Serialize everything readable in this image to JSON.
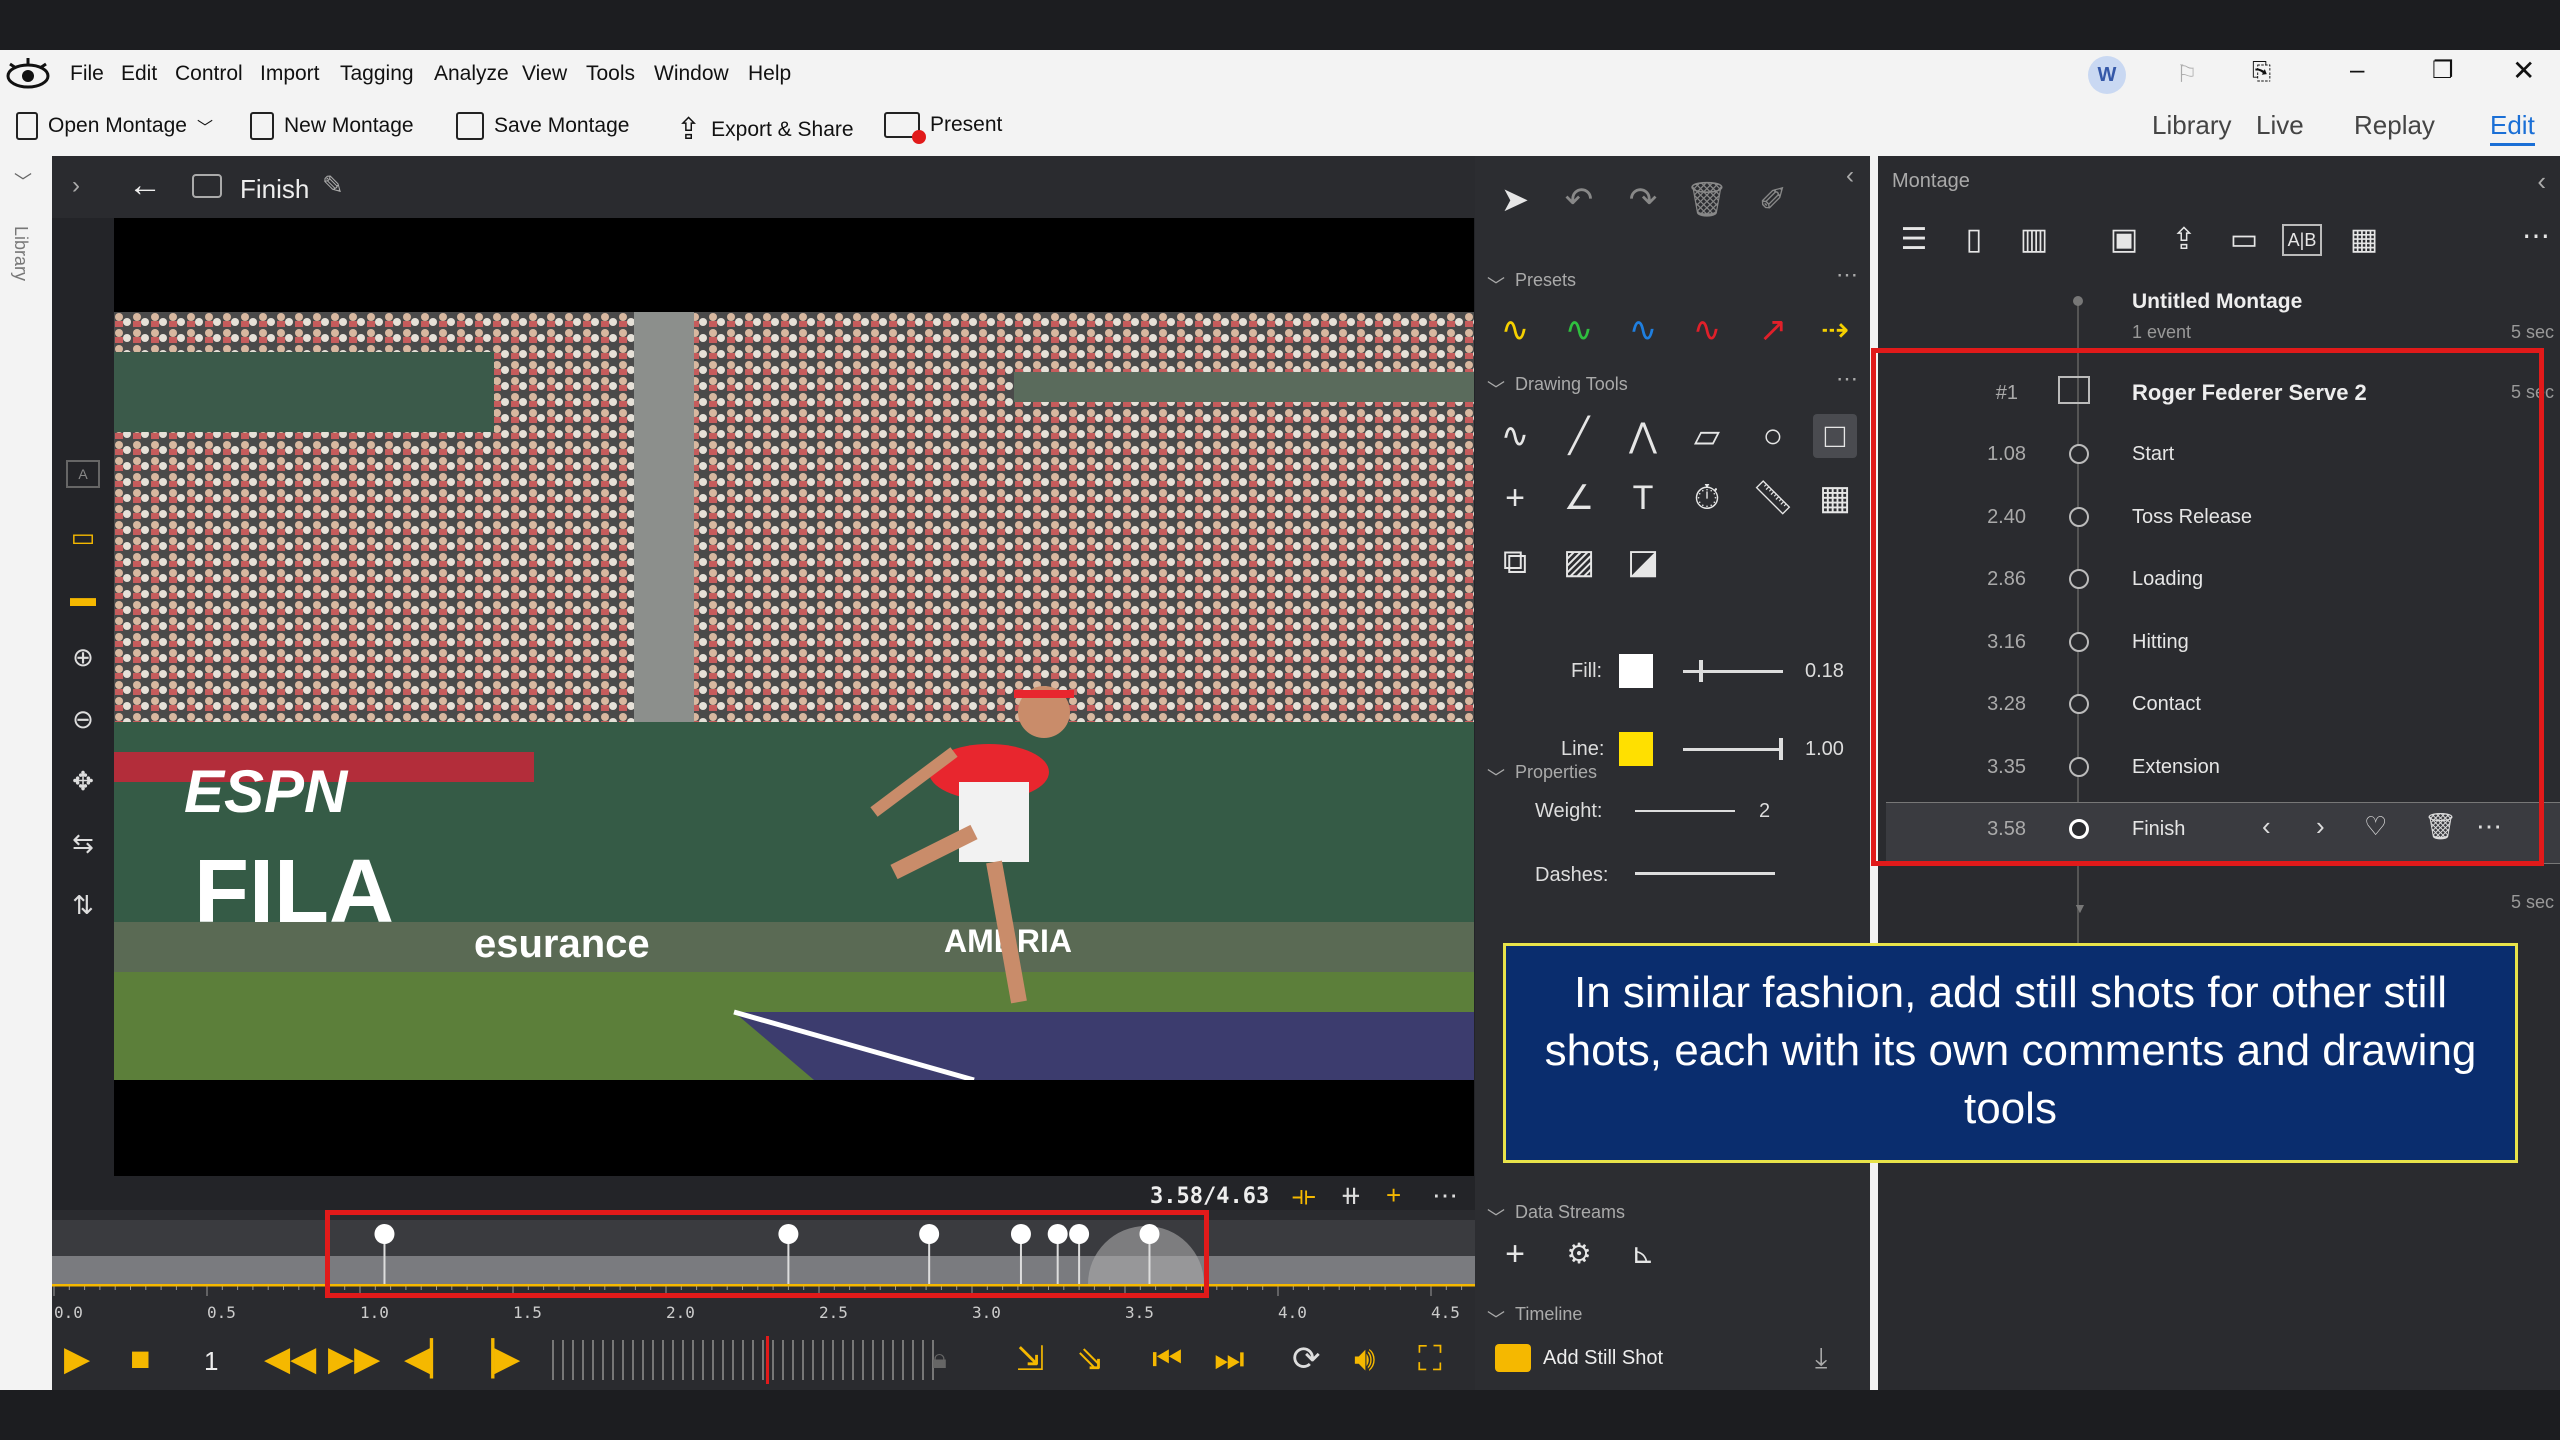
{
  "menu": {
    "items": [
      "File",
      "Edit",
      "Control",
      "Import",
      "Tagging",
      "Analyze",
      "View",
      "Tools",
      "Window",
      "Help"
    ],
    "avatar": "W"
  },
  "toolbar": {
    "open_montage": "Open Montage",
    "new_montage": "New Montage",
    "save_montage": "Save Montage",
    "export_share": "Export & Share",
    "present": "Present",
    "nav": [
      "Library",
      "Live",
      "Replay",
      "Edit"
    ]
  },
  "left_strip": {
    "library_label": "Library"
  },
  "viewer": {
    "title": "Finish",
    "time": "3.58/4.63"
  },
  "tools": {
    "presets_label": "Presets",
    "drawing_tools_label": "Drawing Tools",
    "properties_label": "Properties",
    "fill_label": "Fill:",
    "fill_value": "0.18",
    "line_label": "Line:",
    "line_value": "1.00",
    "weight_label": "Weight:",
    "weight_value": "2",
    "dashes_label": "Dashes:",
    "data_streams_label": "Data Streams",
    "timeline_label": "Timeline",
    "add_still_shot": "Add Still Shot",
    "colors": {
      "fill": "#ffffff",
      "line": "#ffe000"
    }
  },
  "montage": {
    "panel_title": "Montage",
    "name": "Untitled Montage",
    "events": "1 event",
    "duration_top": "5 sec",
    "clip": {
      "index": "#1",
      "title": "Roger Federer Serve 2",
      "duration": "5 sec"
    },
    "rows": [
      {
        "time": "1.08",
        "label": "Start"
      },
      {
        "time": "2.40",
        "label": "Toss Release"
      },
      {
        "time": "2.86",
        "label": "Loading"
      },
      {
        "time": "3.16",
        "label": "Hitting"
      },
      {
        "time": "3.28",
        "label": "Contact"
      },
      {
        "time": "3.35",
        "label": "Extension"
      },
      {
        "time": "3.58",
        "label": "Finish"
      }
    ],
    "duration_bottom": "5 sec"
  },
  "timeline": {
    "ticks": [
      "0.0",
      "0.5",
      "1.0",
      "1.5",
      "2.0",
      "2.5",
      "3.0",
      "3.5",
      "4.0",
      "4.5"
    ],
    "speed": "1"
  },
  "caption": "In similar fashion, add still shots for other still shots, each with its own comments and drawing tools"
}
